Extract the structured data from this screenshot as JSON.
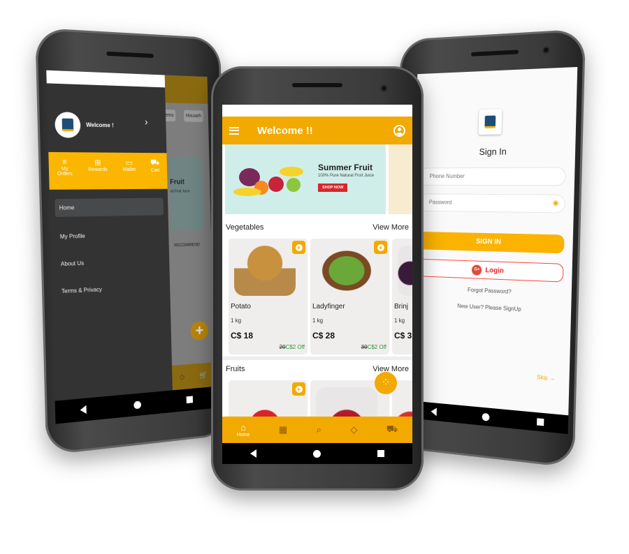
{
  "colors": {
    "accent": "#f2a900",
    "drawer": "#333333",
    "google": "#dd4b39",
    "discount": "#2a9a3a"
  },
  "left_phone": {
    "drawer": {
      "welcome": "Welcome !",
      "chevron": "chevron-right-icon",
      "quick": [
        {
          "label": "My Orders",
          "icon": "list-icon"
        },
        {
          "label": "Rewards",
          "icon": "gift-icon"
        },
        {
          "label": "Wallet",
          "icon": "wallet-icon"
        },
        {
          "label": "Cart",
          "icon": "cart-icon"
        }
      ],
      "menu": [
        "Home",
        "My Profile",
        "About Us",
        "Terms & Privacy"
      ],
      "active": "Home"
    },
    "behind": {
      "tabs": [
        "ems",
        "Househ"
      ],
      "banner_title": "Fruit",
      "banner_sub": "ral Fruit Juice",
      "section": "RECOMMEND"
    }
  },
  "middle_phone": {
    "header": {
      "title": "Welcome !!",
      "menu_icon": "hamburger-icon",
      "profile_icon": "user-circle-icon"
    },
    "banner": {
      "title": "Summer Fruit",
      "subtitle": "100% Pure Natural Fruit Juice",
      "button": "SHOP NOW"
    },
    "vegetables": {
      "title": "Vegetables",
      "view_more": "View More",
      "items": [
        {
          "name": "Potato",
          "qty": "1 kg",
          "price": "C$ 18",
          "old": "20",
          "off": "C$2 Off"
        },
        {
          "name": "Ladyfinger",
          "qty": "1 kg",
          "price": "C$ 28",
          "old": "30",
          "off": "C$2 Off"
        },
        {
          "name": "Brinj",
          "qty": "1 kg",
          "price": "C$ 3",
          "old": "",
          "off": ""
        }
      ]
    },
    "fruits": {
      "title": "Fruits",
      "view_more": "View More"
    },
    "bottom_nav": [
      {
        "label": "Home",
        "icon": "home-icon",
        "active": true
      },
      {
        "label": "",
        "icon": "qr-code-icon"
      },
      {
        "label": "",
        "icon": "search-icon"
      },
      {
        "label": "",
        "icon": "diamond-icon"
      },
      {
        "label": "",
        "icon": "cart-icon"
      }
    ]
  },
  "right_phone": {
    "title": "Sign In",
    "phone_placeholder": "Phone Number",
    "password_placeholder": "Password",
    "sign_in": "SIGN IN",
    "google_badge": "G+",
    "google_login": "Login",
    "forgot": "Forgot Password?",
    "signup": "New User? Please SignUp",
    "skip": "Skip →"
  }
}
